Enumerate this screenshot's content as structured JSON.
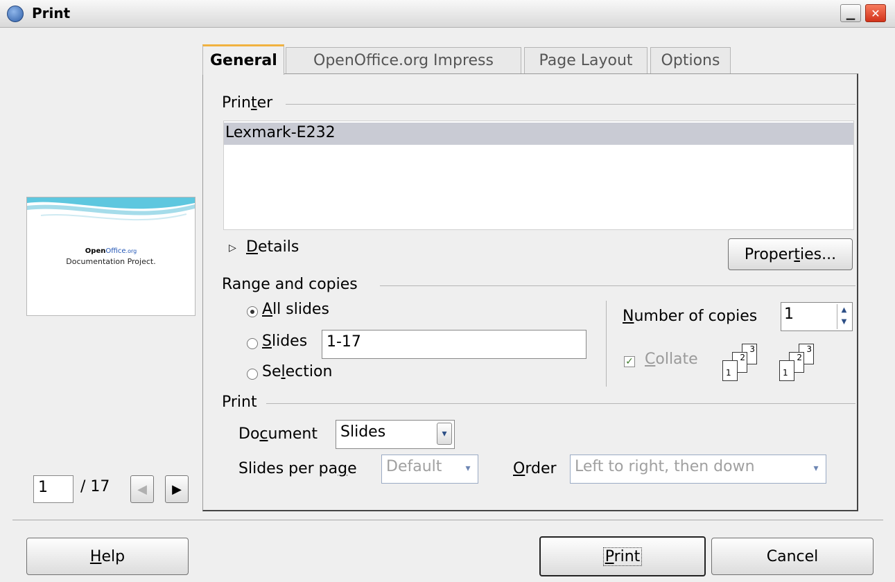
{
  "window": {
    "title": "Print",
    "minimize_icon": "minimize-icon",
    "close_icon": "close-icon"
  },
  "preview": {
    "logo_open": "Open",
    "logo_office": "Office",
    "logo_org": ".org",
    "subtitle": "Documentation Project."
  },
  "pager": {
    "current": "1",
    "total": "/ 17"
  },
  "tabs": [
    {
      "label": "General"
    },
    {
      "label": "OpenOffice.org Impress"
    },
    {
      "label": "Page Layout"
    },
    {
      "label": "Options"
    }
  ],
  "printer": {
    "section_pre": "Prin",
    "section_mn": "t",
    "section_post": "er",
    "selected": "Lexmark-E232",
    "details_mn": "D",
    "details_rest": "etails",
    "properties_pre": "Proper",
    "properties_mn": "t",
    "properties_post": "ies..."
  },
  "range": {
    "section": "Range and copies",
    "all_mn": "A",
    "all_rest": "ll slides",
    "slides_mn": "S",
    "slides_rest": "lides",
    "slides_value": "1-17",
    "selection_pre": "Se",
    "selection_mn": "l",
    "selection_post": "ection",
    "copies_mn": "N",
    "copies_rest": "umber of copies",
    "copies_value": "1",
    "collate_mn": "C",
    "collate_rest": "ollate"
  },
  "print": {
    "section": "Print",
    "document_pre": "Do",
    "document_mn": "c",
    "document_post": "ument",
    "document_value": "Slides",
    "spp_pre": "Slides per pa",
    "spp_mn": "g",
    "spp_post": "e",
    "spp_value": "Default",
    "order_mn": "O",
    "order_rest": "rder",
    "order_value": "Left to right, then down"
  },
  "buttons": {
    "help_mn": "H",
    "help_rest": "elp",
    "print_mn": "P",
    "print_rest": "rint",
    "cancel": "Cancel"
  }
}
